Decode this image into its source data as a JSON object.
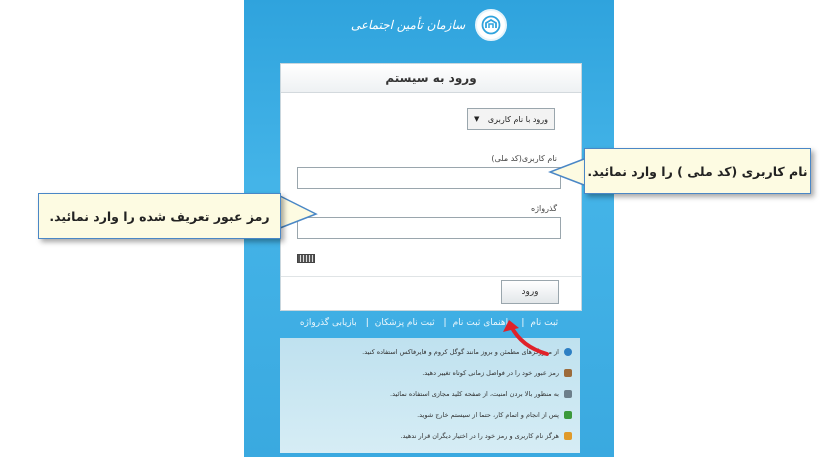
{
  "brand": {
    "name": "سازمان تأمین اجتماعی",
    "logo_icon": "tamin-logo-icon"
  },
  "card": {
    "title": "ورود به سیستم",
    "login_method": {
      "selected": "ورود با نام کاربری",
      "icon": "caret-down-icon"
    },
    "username_label": "نام کاربری(کد ملی)",
    "username_value": "",
    "password_label": "گذرواژه",
    "password_value": "",
    "keyboard_icon": "virtual-keyboard-icon",
    "submit_label": "ورود"
  },
  "links": [
    "ثبت نام",
    "راهنمای ثبت نام",
    "ثبت نام پزشکان",
    "بازیابی گذرواژه"
  ],
  "tips": [
    {
      "text": "از مرورگرهای مطمئن و بروز مانند گوگل کروم و فایرفاکس استفاده کنید.",
      "icon": "browser-icon",
      "color": "#2d7fc4"
    },
    {
      "text": "رمز عبور خود را در فواصل زمانی کوتاه تغییر دهید.",
      "icon": "key-icon",
      "color": "#9c6b3b"
    },
    {
      "text": "به منظور بالا بردن امنیت، از صفحه کلید مجازی استفاده نمائید.",
      "icon": "keyboard-icon",
      "color": "#6d7f8b"
    },
    {
      "text": "پس از انجام و اتمام کار، حتما از سیستم خارج شوید.",
      "icon": "exit-icon",
      "color": "#3c9a3c"
    },
    {
      "text": "هرگز نام کاربری و رمز خود را در اختیار دیگران قرار ندهید.",
      "icon": "users-icon",
      "color": "#e09a2a"
    }
  ],
  "callouts": {
    "username": "نام کاربری (کد ملی ) را وارد نمائید.",
    "password": "رمز عبور تعریف شده را وارد نمائید."
  },
  "colors": {
    "panel": "#3aa9e0",
    "callout_border": "#4a87c6",
    "callout_fill": "#fdfbe2",
    "arrow": "#e0222a"
  }
}
